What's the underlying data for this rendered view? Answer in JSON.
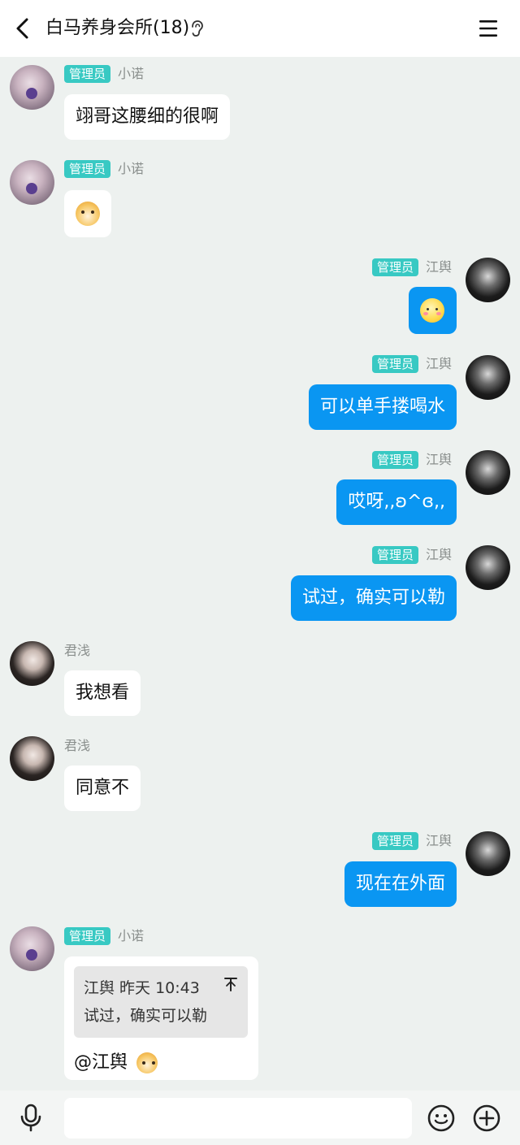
{
  "header": {
    "title": "白马养身会所(18)"
  },
  "messages": [
    {
      "tag": "管理员",
      "nick": "小诺",
      "text": "翊哥这腰细的很啊"
    },
    {
      "tag": "管理员",
      "nick": "小诺",
      "emoji": "doge-emoji"
    },
    {
      "tag": "管理员",
      "nick": "江舆",
      "emoji": "blush-emoji"
    },
    {
      "tag": "管理员",
      "nick": "江舆",
      "text": "可以单手搂喝水"
    },
    {
      "tag": "管理员",
      "nick": "江舆",
      "text": "哎呀,,ʚ^ɞ,,"
    },
    {
      "tag": "管理员",
      "nick": "江舆",
      "text": "试过，确实可以勒"
    },
    {
      "nick": "君浅",
      "text": "我想看"
    },
    {
      "nick": "君浅",
      "text": "同意不"
    },
    {
      "tag": "管理员",
      "nick": "江舆",
      "text": "现在在外面"
    },
    {
      "tag": "管理员",
      "nick": "小诺",
      "quote": {
        "meta": "江舆 昨天 10:43",
        "text": "试过，确实可以勒"
      },
      "text": "@江舆"
    }
  ],
  "input": {
    "value": "",
    "placeholder": ""
  },
  "colors": {
    "background": "#edf1ef",
    "self_bubble": "#0a96f2",
    "admin_tag": "#38c9c3"
  }
}
